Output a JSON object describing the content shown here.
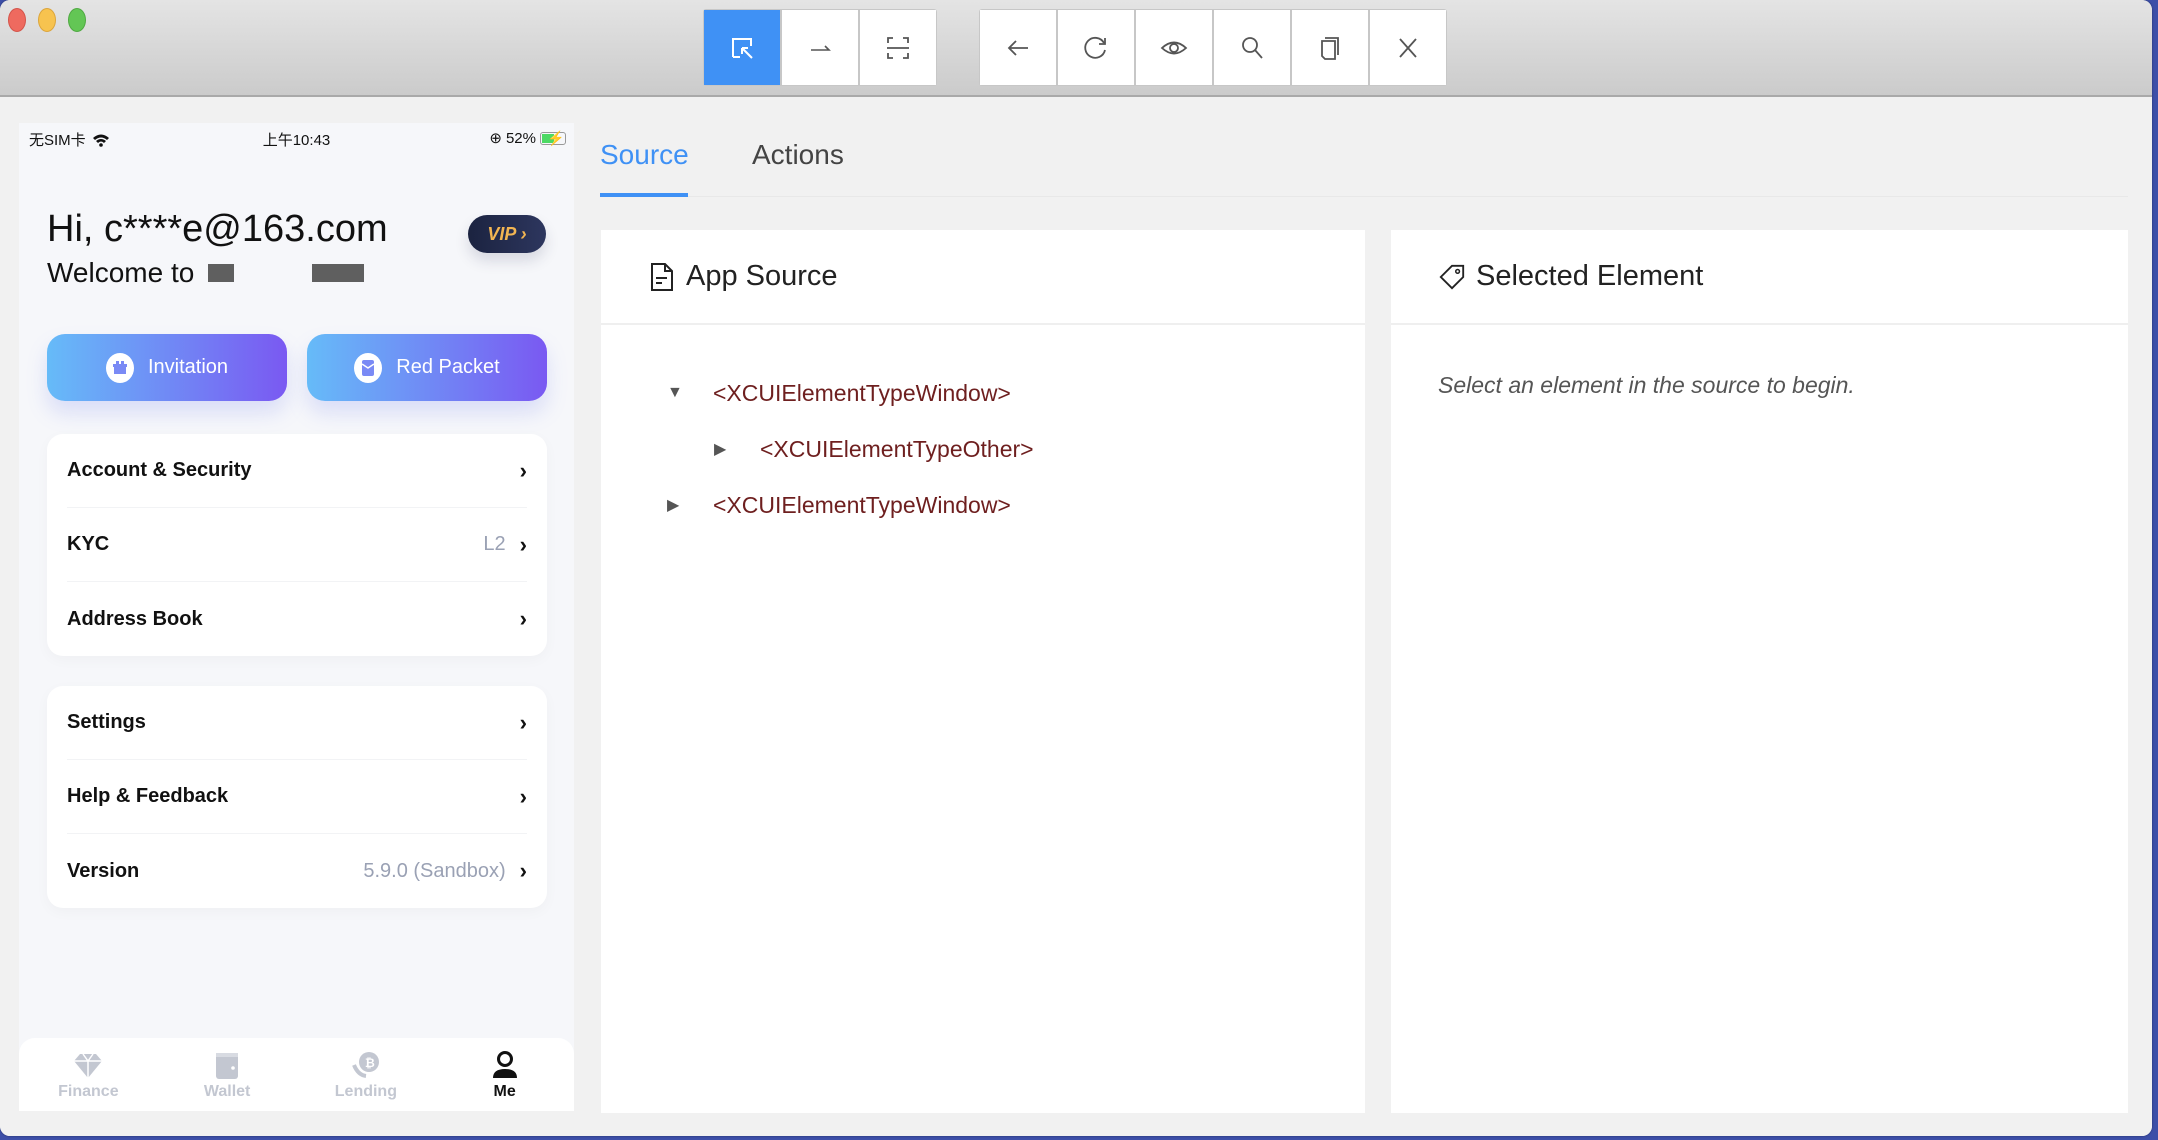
{
  "window": {
    "traffic_lights": [
      "close",
      "minimize",
      "zoom"
    ]
  },
  "toolbar": {
    "group1": [
      {
        "name": "select-elements",
        "icon": "select-cursor-icon",
        "active": true
      },
      {
        "name": "swipe-by-coordinates",
        "icon": "swipe-icon",
        "active": false
      },
      {
        "name": "tap-by-coordinates",
        "icon": "scan-icon",
        "active": false
      }
    ],
    "group2": [
      {
        "name": "back",
        "icon": "arrow-left-icon"
      },
      {
        "name": "refresh-source",
        "icon": "refresh-icon"
      },
      {
        "name": "start-recording",
        "icon": "eye-icon"
      },
      {
        "name": "search-elements",
        "icon": "search-icon"
      },
      {
        "name": "copy-xml-source",
        "icon": "copy-icon"
      },
      {
        "name": "quit-session",
        "icon": "close-icon"
      }
    ]
  },
  "phone": {
    "status_bar": {
      "carrier": "无SIM卡",
      "time": "上午10:43",
      "battery": "52%"
    },
    "greeting": "Hi, c****e@163.com",
    "welcome": "Welcome to",
    "vip_label": "VIP ›",
    "buttons": {
      "invitation": "Invitation",
      "red_packet": "Red Packet"
    },
    "menu_group1": [
      {
        "label": "Account & Security",
        "value": ""
      },
      {
        "label": "KYC",
        "value": "L2"
      },
      {
        "label": "Address Book",
        "value": ""
      }
    ],
    "menu_group2": [
      {
        "label": "Settings",
        "value": ""
      },
      {
        "label": "Help & Feedback",
        "value": ""
      },
      {
        "label": "Version",
        "value": "5.9.0 (Sandbox)"
      }
    ],
    "chevron": "›",
    "bottom_nav": [
      {
        "label": "Finance",
        "icon": "diamond-icon",
        "active": false
      },
      {
        "label": "Wallet",
        "icon": "wallet-icon",
        "active": false
      },
      {
        "label": "Lending",
        "icon": "bitcoin-hand-icon",
        "active": false
      },
      {
        "label": "Me",
        "icon": "user-icon",
        "active": true
      }
    ]
  },
  "inspector": {
    "tabs": [
      {
        "label": "Source",
        "active": true
      },
      {
        "label": "Actions",
        "active": false
      }
    ],
    "app_source": {
      "title": "App Source",
      "tree": [
        {
          "tag": "<XCUIElementTypeWindow>",
          "expanded": true,
          "level": 0
        },
        {
          "tag": "<XCUIElementTypeOther>",
          "expanded": false,
          "level": 1
        },
        {
          "tag": "<XCUIElementTypeWindow>",
          "expanded": false,
          "level": 0
        }
      ]
    },
    "selected_element": {
      "title": "Selected Element",
      "placeholder": "Select an element in the source to begin."
    }
  },
  "colors": {
    "accent": "#3f91f5",
    "tree_tag": "#6e1f1f",
    "vip_gold": "#f2b552",
    "button_gradient_start": "#66bbf8",
    "button_gradient_end": "#7a59f2"
  }
}
